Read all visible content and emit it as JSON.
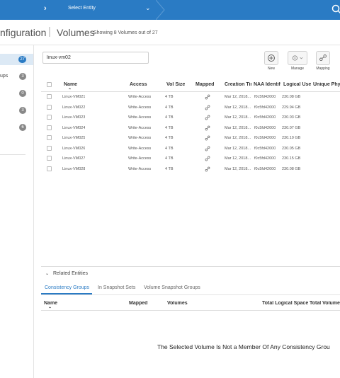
{
  "topbar": {
    "entity_select": "Select Entity"
  },
  "title": {
    "page": "nfiguration",
    "section": "Volumes",
    "count": "Showing 8 Volumes out of 27"
  },
  "sidebar": {
    "items": [
      {
        "label": "",
        "badge": "27",
        "active": true
      },
      {
        "label": "ups",
        "badge": "3",
        "active": false
      },
      {
        "label": "",
        "badge": "0",
        "active": false
      },
      {
        "label": "",
        "badge": "3",
        "active": false
      },
      {
        "label": "",
        "badge": "6",
        "active": false
      }
    ]
  },
  "filter": {
    "value": "linux-vm02"
  },
  "toolbar": {
    "new_label": "New",
    "manage_label": "Manage",
    "mapping_label": "Mapping"
  },
  "grid": {
    "columns": [
      "Name",
      "Access",
      "Vol Size",
      "Mapped",
      "Creation Tir",
      "NAA Identif",
      "Logical Use",
      "Unique Phy"
    ],
    "rows": [
      {
        "name": "Linux-VM021",
        "access": "Write-Access",
        "size": "4 TB",
        "created": "Mar 12, 2018...",
        "naa": "f0c5fd42000",
        "logical": "230.08 GB"
      },
      {
        "name": "Linux-VM022",
        "access": "Write-Access",
        "size": "4 TB",
        "created": "Mar 12, 2018...",
        "naa": "f0c5fd42000",
        "logical": "229.94 GB"
      },
      {
        "name": "Linux-VM023",
        "access": "Write-Access",
        "size": "4 TB",
        "created": "Mar 12, 2018...",
        "naa": "f0c5fd42000",
        "logical": "230.03 GB"
      },
      {
        "name": "Linux-VM024",
        "access": "Write-Access",
        "size": "4 TB",
        "created": "Mar 12, 2018...",
        "naa": "f0c5fd42000",
        "logical": "230.07 GB"
      },
      {
        "name": "Linux-VM025",
        "access": "Write-Access",
        "size": "4 TB",
        "created": "Mar 12, 2018...",
        "naa": "f0c5fd42000",
        "logical": "230.10 GB"
      },
      {
        "name": "Linux-VM026",
        "access": "Write-Access",
        "size": "4 TB",
        "created": "Mar 12, 2018...",
        "naa": "f0c5fd42000",
        "logical": "230.05 GB"
      },
      {
        "name": "Linux-VM027",
        "access": "Write-Access",
        "size": "4 TB",
        "created": "Mar 12, 2018...",
        "naa": "f0c5fd42000",
        "logical": "230.15 GB"
      },
      {
        "name": "Linux-VM028",
        "access": "Write-Access",
        "size": "4 TB",
        "created": "Mar 12, 2018...",
        "naa": "f0c5fd42000",
        "logical": "230.08 GB"
      }
    ]
  },
  "related": {
    "title": "Related Entities",
    "tabs": [
      "Consistency Groups",
      "In Snapshot Sets",
      "Volume Snapshot Groups"
    ],
    "columns": [
      "Name",
      "Mapped",
      "Volumes",
      "Total Logical Space",
      "Total Volume"
    ],
    "empty_message": "The Selected Volume Is Not a Member Of Any Consistency Grou"
  },
  "colors": {
    "accent": "#2a7bc4",
    "topbar": "#2a7bc4"
  }
}
